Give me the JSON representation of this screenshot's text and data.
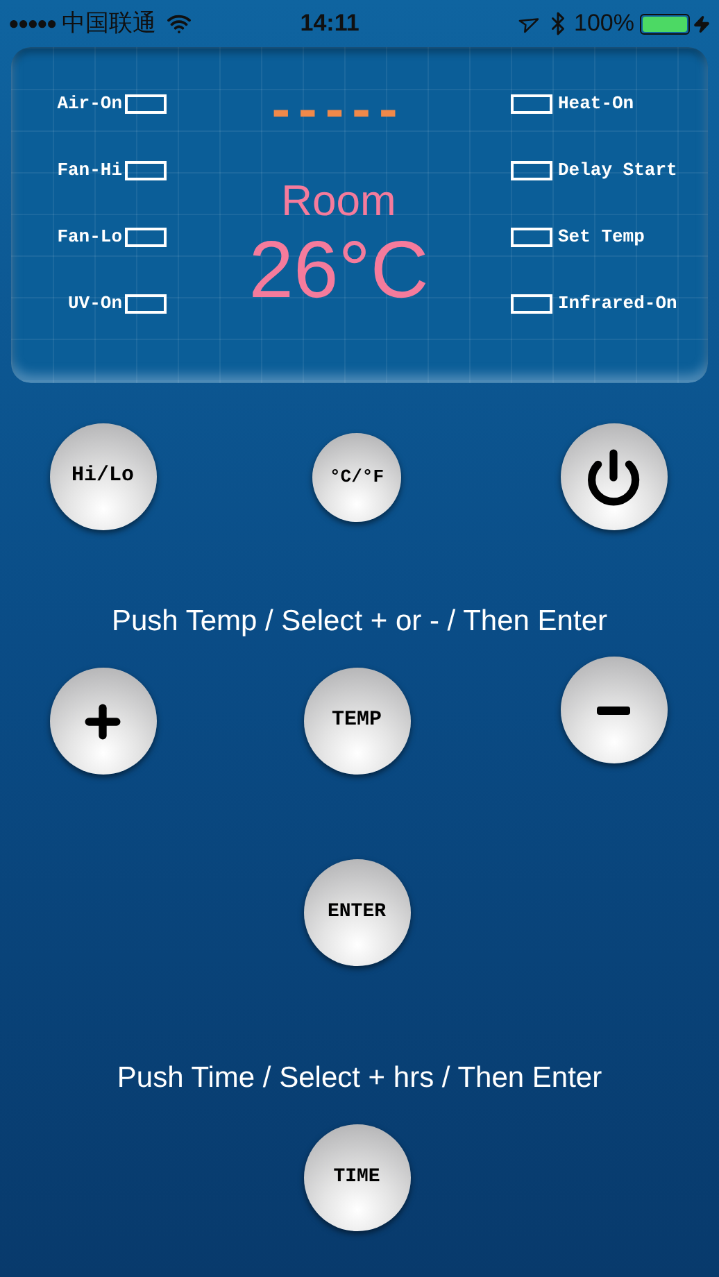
{
  "status_bar": {
    "signal_dots": "●●●●●",
    "carrier": "中国联通",
    "time": "14:11",
    "battery": "100%"
  },
  "display": {
    "dashes": "-----",
    "caption": "Room",
    "temperature": "26°C",
    "left_indicators": [
      {
        "label": "Air-On",
        "on": false
      },
      {
        "label": "Fan-Hi",
        "on": false
      },
      {
        "label": "Fan-Lo",
        "on": false
      },
      {
        "label": "UV-On",
        "on": false
      }
    ],
    "right_indicators": [
      {
        "label": "Heat-On",
        "on": false
      },
      {
        "label": "Delay Start",
        "on": false
      },
      {
        "label": "Set Temp",
        "on": false
      },
      {
        "label": "Infrared-On",
        "on": false
      }
    ]
  },
  "row_1": [
    {
      "kind": "text",
      "label": "Hi/Lo"
    },
    {
      "kind": "small",
      "label": "°C/°F"
    },
    {
      "kind": "power"
    }
  ],
  "hint_1": "Push Temp / Select + or - / Then Enter",
  "row_2": [
    {
      "kind": "plus"
    },
    {
      "kind": "text",
      "label": "TEMP"
    },
    {
      "kind": "minus"
    }
  ],
  "enter_button": {
    "label": "ENTER"
  },
  "hint_2": "Push Time / Select + hrs / Then Enter",
  "time_button": {
    "label": "TIME"
  }
}
